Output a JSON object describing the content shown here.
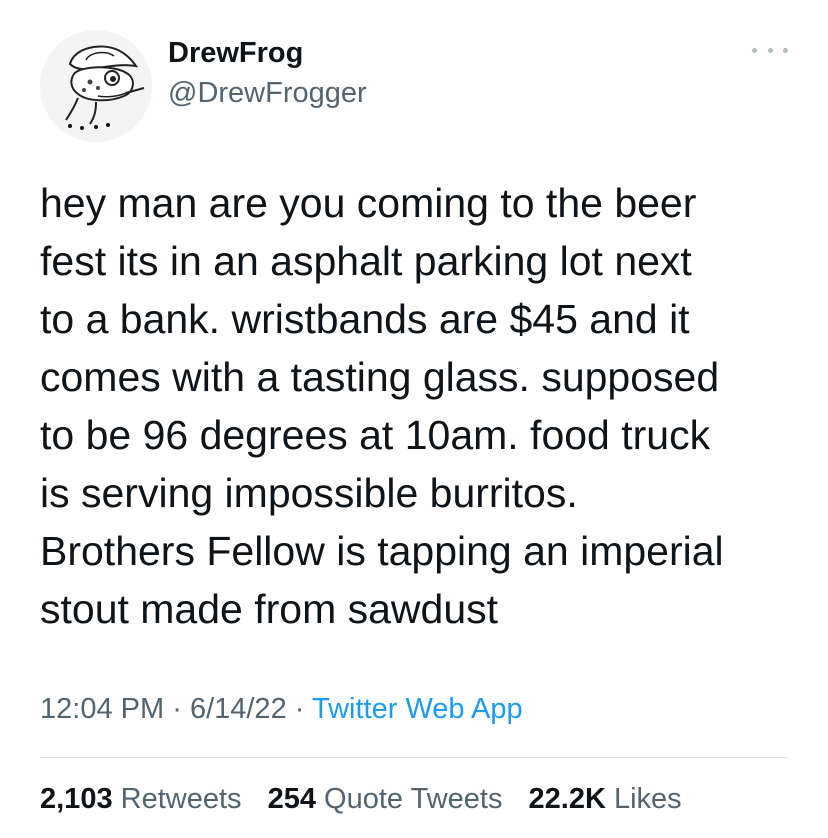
{
  "user": {
    "display_name": "DrewFrog",
    "handle": "@DrewFrogger"
  },
  "tweet": {
    "text": "hey man are you coming to the beer\nfest its in an asphalt parking lot next\nto a bank. wristbands are $45 and it\ncomes with a tasting glass. supposed\nto be 96 degrees at 10am. food truck\nis serving impossible burritos.\nBrothers Fellow is tapping an imperial\nstout made from sawdust",
    "time": "12:04 PM",
    "date": "6/14/22",
    "separator": "·",
    "source": "Twitter Web App"
  },
  "stats": {
    "retweets_count": "2,103",
    "retweets_label": "Retweets",
    "quotes_count": "254",
    "quotes_label": "Quote Tweets",
    "likes_count": "22.2K",
    "likes_label": "Likes"
  },
  "icons": {
    "avatar": "frog-with-cowboy-hat-avatar",
    "more": "more-options-icon"
  },
  "colors": {
    "text_primary": "#0f1419",
    "text_secondary": "#536471",
    "link": "#1d9bf0",
    "divider": "#e1e6ea"
  }
}
